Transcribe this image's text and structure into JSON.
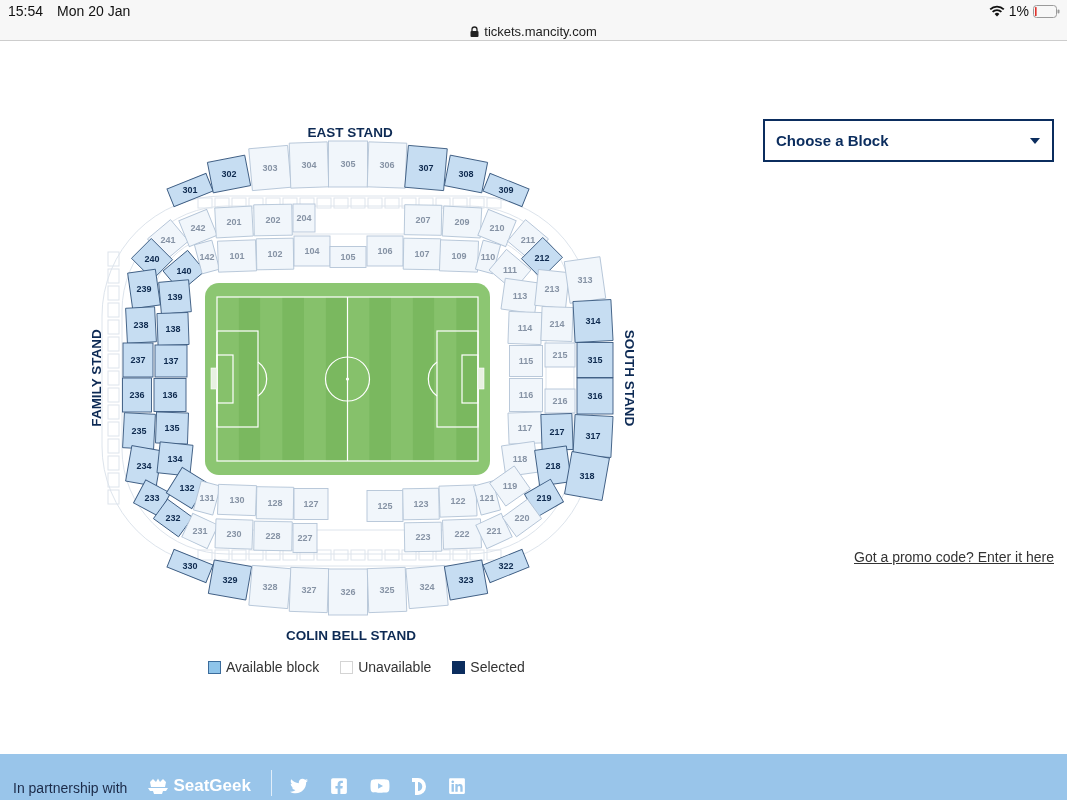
{
  "status_bar": {
    "time": "15:54",
    "date": "Mon 20 Jan",
    "battery": "1%"
  },
  "address_bar": {
    "url": "tickets.mancity.com"
  },
  "seat_map": {
    "stands": [
      {
        "label": "EAST STAND"
      },
      {
        "label": "FAMILY STAND"
      },
      {
        "label": "SOUTH STAND"
      },
      {
        "label": "COLIN BELL STAND"
      }
    ],
    "blocks": [
      {
        "label": "301",
        "available": true,
        "selected": false
      },
      {
        "label": "302",
        "available": true,
        "selected": false
      },
      {
        "label": "303",
        "available": false,
        "selected": false
      },
      {
        "label": "304",
        "available": false,
        "selected": false
      },
      {
        "label": "305",
        "available": false,
        "selected": false
      },
      {
        "label": "306",
        "available": false,
        "selected": false
      },
      {
        "label": "307",
        "available": true,
        "selected": false
      },
      {
        "label": "308",
        "available": true,
        "selected": false
      },
      {
        "label": "309",
        "available": true,
        "selected": false
      },
      {
        "label": "241",
        "available": false,
        "selected": false
      },
      {
        "label": "242",
        "available": false,
        "selected": false
      },
      {
        "label": "201",
        "available": false,
        "selected": false
      },
      {
        "label": "202",
        "available": false,
        "selected": false
      },
      {
        "label": "204",
        "available": false,
        "selected": false
      },
      {
        "label": "207",
        "available": false,
        "selected": false
      },
      {
        "label": "209",
        "available": false,
        "selected": false
      },
      {
        "label": "210",
        "available": false,
        "selected": false
      },
      {
        "label": "211",
        "available": false,
        "selected": false
      },
      {
        "label": "240",
        "available": true,
        "selected": false
      },
      {
        "label": "140",
        "available": true,
        "selected": false
      },
      {
        "label": "142",
        "available": false,
        "selected": false
      },
      {
        "label": "101",
        "available": false,
        "selected": false
      },
      {
        "label": "102",
        "available": false,
        "selected": false
      },
      {
        "label": "104",
        "available": false,
        "selected": false
      },
      {
        "label": "105",
        "available": false,
        "selected": false
      },
      {
        "label": "106",
        "available": false,
        "selected": false
      },
      {
        "label": "107",
        "available": false,
        "selected": false
      },
      {
        "label": "109",
        "available": false,
        "selected": false
      },
      {
        "label": "110",
        "available": false,
        "selected": false
      },
      {
        "label": "111",
        "available": false,
        "selected": false
      },
      {
        "label": "212",
        "available": true,
        "selected": false
      },
      {
        "label": "239",
        "available": true,
        "selected": false
      },
      {
        "label": "139",
        "available": true,
        "selected": false
      },
      {
        "label": "113",
        "available": false,
        "selected": false
      },
      {
        "label": "213",
        "available": false,
        "selected": false
      },
      {
        "label": "313",
        "available": false,
        "selected": false
      },
      {
        "label": "238",
        "available": true,
        "selected": false
      },
      {
        "label": "138",
        "available": true,
        "selected": false
      },
      {
        "label": "114",
        "available": false,
        "selected": false
      },
      {
        "label": "214",
        "available": false,
        "selected": false
      },
      {
        "label": "314",
        "available": true,
        "selected": false
      },
      {
        "label": "237",
        "available": true,
        "selected": false
      },
      {
        "label": "137",
        "available": true,
        "selected": false
      },
      {
        "label": "115",
        "available": false,
        "selected": false
      },
      {
        "label": "215",
        "available": false,
        "selected": false
      },
      {
        "label": "315",
        "available": true,
        "selected": false
      },
      {
        "label": "236",
        "available": true,
        "selected": false
      },
      {
        "label": "136",
        "available": true,
        "selected": false
      },
      {
        "label": "116",
        "available": false,
        "selected": false
      },
      {
        "label": "216",
        "available": false,
        "selected": false
      },
      {
        "label": "316",
        "available": true,
        "selected": false
      },
      {
        "label": "235",
        "available": true,
        "selected": false
      },
      {
        "label": "135",
        "available": true,
        "selected": false
      },
      {
        "label": "117",
        "available": false,
        "selected": false
      },
      {
        "label": "217",
        "available": true,
        "selected": false
      },
      {
        "label": "317",
        "available": true,
        "selected": false
      },
      {
        "label": "234",
        "available": true,
        "selected": false
      },
      {
        "label": "134",
        "available": true,
        "selected": false
      },
      {
        "label": "118",
        "available": false,
        "selected": false
      },
      {
        "label": "218",
        "available": true,
        "selected": false
      },
      {
        "label": "318",
        "available": true,
        "selected": false
      },
      {
        "label": "233",
        "available": true,
        "selected": false
      },
      {
        "label": "132",
        "available": true,
        "selected": false
      },
      {
        "label": "131",
        "available": false,
        "selected": false
      },
      {
        "label": "130",
        "available": false,
        "selected": false
      },
      {
        "label": "128",
        "available": false,
        "selected": false
      },
      {
        "label": "127",
        "available": false,
        "selected": false
      },
      {
        "label": "125",
        "available": false,
        "selected": false
      },
      {
        "label": "123",
        "available": false,
        "selected": false
      },
      {
        "label": "122",
        "available": false,
        "selected": false
      },
      {
        "label": "121",
        "available": false,
        "selected": false
      },
      {
        "label": "119",
        "available": false,
        "selected": false
      },
      {
        "label": "219",
        "available": true,
        "selected": false
      },
      {
        "label": "232",
        "available": true,
        "selected": false
      },
      {
        "label": "231",
        "available": false,
        "selected": false
      },
      {
        "label": "230",
        "available": false,
        "selected": false
      },
      {
        "label": "228",
        "available": false,
        "selected": false
      },
      {
        "label": "227",
        "available": false,
        "selected": false
      },
      {
        "label": "223",
        "available": false,
        "selected": false
      },
      {
        "label": "222",
        "available": false,
        "selected": false
      },
      {
        "label": "221",
        "available": false,
        "selected": false
      },
      {
        "label": "220",
        "available": false,
        "selected": false
      },
      {
        "label": "330",
        "available": true,
        "selected": false
      },
      {
        "label": "329",
        "available": true,
        "selected": false
      },
      {
        "label": "328",
        "available": false,
        "selected": false
      },
      {
        "label": "327",
        "available": false,
        "selected": false
      },
      {
        "label": "326",
        "available": false,
        "selected": false
      },
      {
        "label": "325",
        "available": false,
        "selected": false
      },
      {
        "label": "324",
        "available": false,
        "selected": false
      },
      {
        "label": "323",
        "available": true,
        "selected": false
      },
      {
        "label": "322",
        "available": true,
        "selected": false
      }
    ]
  },
  "legend": [
    {
      "label": "Available block",
      "kind": "available"
    },
    {
      "label": "Unavailable",
      "kind": "unavailable"
    },
    {
      "label": "Selected",
      "kind": "selected"
    }
  ],
  "block_picker": {
    "placeholder": "Choose a Block"
  },
  "promo_link": "Got a promo code? Enter it here",
  "footer": {
    "partner_text": "In partnership with",
    "partner_logo": "SeatGeek"
  }
}
